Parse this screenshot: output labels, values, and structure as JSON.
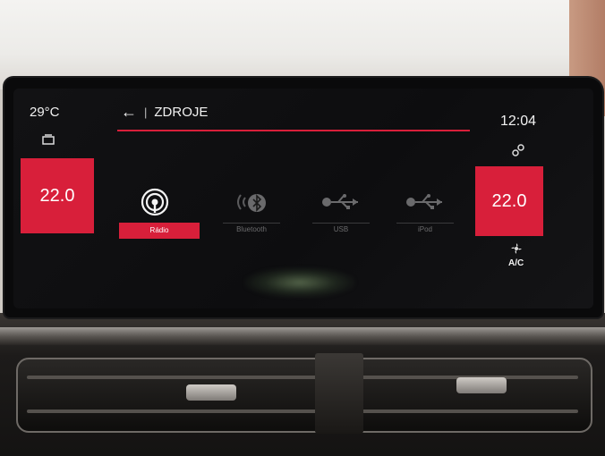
{
  "status": {
    "outside_temp": "29°C",
    "time": "12:04"
  },
  "climate": {
    "left_temp": "22.0",
    "right_temp": "22.0",
    "ac_label": "A/C"
  },
  "header": {
    "back_label": "←",
    "title": "ZDROJE"
  },
  "sources": [
    {
      "label": "Rádio",
      "icon": "radio-icon",
      "active": true
    },
    {
      "label": "Bluetooth",
      "icon": "bluetooth-icon",
      "active": false
    },
    {
      "label": "USB",
      "icon": "usb-icon",
      "active": false
    },
    {
      "label": "iPod",
      "icon": "ipod-usb-icon",
      "active": false
    }
  ],
  "colors": {
    "accent": "#d81f3a",
    "screen_bg": "#0d0d0f"
  }
}
